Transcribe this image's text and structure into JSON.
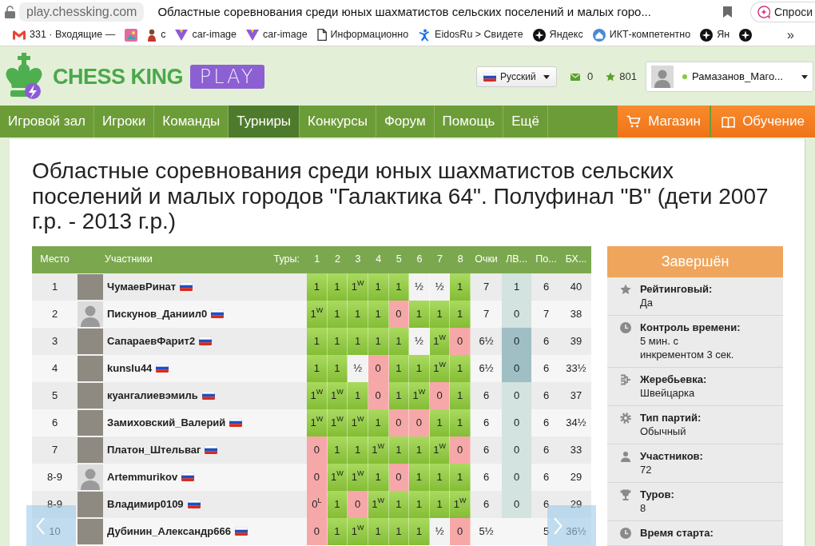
{
  "browser": {
    "url": "play.chessking.com",
    "page_title": "Областные соревнования среди юных шахматистов сельских поселений и малых горо...",
    "assistant_button": "Спроси"
  },
  "bookmarks": [
    {
      "kind": "mail",
      "label": "331 · Входящие —"
    },
    {
      "kind": "picture"
    },
    {
      "kind": "person",
      "label": "с"
    },
    {
      "kind": "v",
      "label": "car-image"
    },
    {
      "kind": "v",
      "label": "car-image"
    },
    {
      "kind": "document",
      "label": "Информационно"
    },
    {
      "kind": "figure",
      "label": "EidosRu > Свидете"
    },
    {
      "kind": "circle",
      "label": "Яндекс"
    },
    {
      "kind": "house",
      "label": "ИКТ-компетентно"
    },
    {
      "kind": "circle",
      "label": "Ян"
    },
    {
      "kind": "circle"
    }
  ],
  "bookmarks_more": "»",
  "header": {
    "logo": {
      "name": "CHESS KING",
      "badge": "PLAY"
    },
    "language": "Русский",
    "messages": "0",
    "rating": "801",
    "user": {
      "name": "Рамазанов_Маго...",
      "online": true
    }
  },
  "nav": [
    {
      "label": "Игровой зал",
      "selected": false
    },
    {
      "label": "Игроки",
      "selected": false
    },
    {
      "label": "Команды",
      "selected": false
    },
    {
      "label": "Турниры",
      "selected": true
    },
    {
      "label": "Конкурсы",
      "selected": false
    },
    {
      "label": "Форум",
      "selected": false
    },
    {
      "label": "Помощь",
      "selected": false
    },
    {
      "label": "Ещё",
      "selected": false
    }
  ],
  "nav_right": [
    {
      "kind": "cart",
      "label": "Магазин"
    },
    {
      "kind": "book",
      "label": "Обучение"
    }
  ],
  "tournament": {
    "title": "Областные соревнования среди юных шахматистов сельских поселений и малых городов \"Галактика 64\". Полуфинал \"В\" (дети 2007 г.р. - 2013 г.р.)",
    "standings": {
      "header": {
        "place": "Место",
        "players": "Участники",
        "rounds_label": "Туры:",
        "rounds": [
          "1",
          "2",
          "3",
          "4",
          "5",
          "6",
          "7",
          "8"
        ],
        "points": "Очки",
        "lv": "ЛВ...",
        "po": "По...",
        "bh": "БХ..."
      },
      "rows": [
        {
          "place": "1",
          "avatar": {
            "kind": "photo"
          },
          "name": "ЧумаевРинат",
          "results": [
            {
              "kind": "win",
              "text": "1"
            },
            {
              "kind": "win",
              "text": "1"
            },
            {
              "kind": "win",
              "text": "1$^{W}$"
            },
            {
              "kind": "win",
              "text": "1"
            },
            {
              "kind": "win",
              "text": "1"
            },
            {
              "kind": "draw",
              "text": "½"
            },
            {
              "kind": "draw",
              "text": "½"
            },
            {
              "kind": "win",
              "text": "1"
            }
          ],
          "points": "7",
          "lv": {
            "kind": "light",
            "text": "1"
          },
          "po": "6",
          "bh": "40"
        },
        {
          "place": "2",
          "avatar": {
            "kind": "default"
          },
          "name": "Пискунов_Даниил0",
          "results": [
            {
              "kind": "win",
              "text": "1$^{W}$"
            },
            {
              "kind": "win",
              "text": "1"
            },
            {
              "kind": "win",
              "text": "1"
            },
            {
              "kind": "win",
              "text": "1"
            },
            {
              "kind": "loss",
              "text": "0"
            },
            {
              "kind": "win",
              "text": "1"
            },
            {
              "kind": "win",
              "text": "1"
            },
            {
              "kind": "win",
              "text": "1"
            }
          ],
          "points": "7",
          "lv": {
            "kind": "light",
            "text": "0"
          },
          "po": "7",
          "bh": "38"
        },
        {
          "place": "3",
          "avatar": {
            "kind": "photo"
          },
          "name": "СапараевФарит2",
          "results": [
            {
              "kind": "win",
              "text": "1"
            },
            {
              "kind": "win",
              "text": "1"
            },
            {
              "kind": "win",
              "text": "1"
            },
            {
              "kind": "win",
              "text": "1"
            },
            {
              "kind": "win",
              "text": "1"
            },
            {
              "kind": "draw",
              "text": "½"
            },
            {
              "kind": "win",
              "text": "1$^{W}$"
            },
            {
              "kind": "loss",
              "text": "0"
            }
          ],
          "points": "6½",
          "lv": {
            "kind": "dark",
            "text": "0"
          },
          "po": "6",
          "bh": "39"
        },
        {
          "place": "4",
          "avatar": {
            "kind": "photo"
          },
          "name": "kunslu44",
          "results": [
            {
              "kind": "win",
              "text": "1"
            },
            {
              "kind": "win",
              "text": "1"
            },
            {
              "kind": "draw",
              "text": "½"
            },
            {
              "kind": "loss",
              "text": "0"
            },
            {
              "kind": "win",
              "text": "1"
            },
            {
              "kind": "win",
              "text": "1"
            },
            {
              "kind": "win",
              "text": "1$^{W}$"
            },
            {
              "kind": "win",
              "text": "1"
            }
          ],
          "points": "6½",
          "lv": {
            "kind": "dark",
            "text": "0"
          },
          "po": "6",
          "bh": "33½"
        },
        {
          "place": "5",
          "avatar": {
            "kind": "photo"
          },
          "name": "куангалиевэмиль",
          "results": [
            {
              "kind": "win",
              "text": "1$^{W}$"
            },
            {
              "kind": "win",
              "text": "1$^{W}$"
            },
            {
              "kind": "win",
              "text": "1"
            },
            {
              "kind": "loss",
              "text": "0"
            },
            {
              "kind": "win",
              "text": "1"
            },
            {
              "kind": "win",
              "text": "1$^{W}$"
            },
            {
              "kind": "loss",
              "text": "0"
            },
            {
              "kind": "win",
              "text": "1"
            }
          ],
          "points": "6",
          "lv": {
            "kind": "light",
            "text": "0"
          },
          "po": "6",
          "bh": "37"
        },
        {
          "place": "6",
          "avatar": {
            "kind": "photo"
          },
          "name": "Замиховский_Валерий",
          "results": [
            {
              "kind": "win",
              "text": "1$^{W}$"
            },
            {
              "kind": "win",
              "text": "1$^{W}$"
            },
            {
              "kind": "win",
              "text": "1$^{W}$"
            },
            {
              "kind": "win",
              "text": "1"
            },
            {
              "kind": "loss",
              "text": "0"
            },
            {
              "kind": "loss",
              "text": "0"
            },
            {
              "kind": "win",
              "text": "1"
            },
            {
              "kind": "win",
              "text": "1"
            }
          ],
          "points": "6",
          "lv": {
            "kind": "light",
            "text": "0"
          },
          "po": "6",
          "bh": "34½"
        },
        {
          "place": "7",
          "avatar": {
            "kind": "photo"
          },
          "name": "Платон_Штельваг",
          "results": [
            {
              "kind": "loss",
              "text": "0"
            },
            {
              "kind": "win",
              "text": "1"
            },
            {
              "kind": "win",
              "text": "1"
            },
            {
              "kind": "win",
              "text": "1$^{W}$"
            },
            {
              "kind": "win",
              "text": "1"
            },
            {
              "kind": "win",
              "text": "1"
            },
            {
              "kind": "win",
              "text": "1$^{W}$"
            },
            {
              "kind": "loss",
              "text": "0"
            }
          ],
          "points": "6",
          "lv": {
            "kind": "light",
            "text": "0"
          },
          "po": "6",
          "bh": "33"
        },
        {
          "place": "8-9",
          "avatar": {
            "kind": "default"
          },
          "name": "Artemmurikov",
          "results": [
            {
              "kind": "loss",
              "text": "0"
            },
            {
              "kind": "win",
              "text": "1$^{W}$"
            },
            {
              "kind": "win",
              "text": "1$^{W}$"
            },
            {
              "kind": "win",
              "text": "1"
            },
            {
              "kind": "loss",
              "text": "0"
            },
            {
              "kind": "win",
              "text": "1"
            },
            {
              "kind": "win",
              "text": "1"
            },
            {
              "kind": "win",
              "text": "1"
            }
          ],
          "points": "6",
          "lv": {
            "kind": "light",
            "text": "0"
          },
          "po": "6",
          "bh": "29"
        },
        {
          "place": "8-9",
          "avatar": {
            "kind": "photo"
          },
          "name": "Владимир0109",
          "results": [
            {
              "kind": "loss",
              "text": "0$^{L}$"
            },
            {
              "kind": "win",
              "text": "1"
            },
            {
              "kind": "loss",
              "text": "0"
            },
            {
              "kind": "win",
              "text": "1$^{W}$"
            },
            {
              "kind": "win",
              "text": "1"
            },
            {
              "kind": "win",
              "text": "1"
            },
            {
              "kind": "win",
              "text": "1"
            },
            {
              "kind": "win",
              "text": "1$^{W}$"
            }
          ],
          "points": "6",
          "lv": {
            "kind": "light",
            "text": "0"
          },
          "po": "6",
          "bh": "29"
        },
        {
          "place": "10",
          "avatar": {
            "kind": "photo"
          },
          "name": "Дубинин_Александр666",
          "results": [
            {
              "kind": "loss",
              "text": "0"
            },
            {
              "kind": "win",
              "text": "1"
            },
            {
              "kind": "win",
              "text": "1$^{W}$"
            },
            {
              "kind": "win",
              "text": "1"
            },
            {
              "kind": "win",
              "text": "1"
            },
            {
              "kind": "win",
              "text": "1"
            },
            {
              "kind": "draw",
              "text": "½"
            },
            {
              "kind": "loss",
              "text": "0"
            }
          ],
          "points": "5½",
          "lv": {
            "kind": "none"
          },
          "po": "5",
          "bh": "36½"
        }
      ]
    },
    "info": {
      "status": "Завершён",
      "items": [
        {
          "kind": "star",
          "label": "Рейтинговый:",
          "value": "Да"
        },
        {
          "kind": "clock",
          "label": "Контроль времени:",
          "value": "5 мин. с инкрементом 3 сек."
        },
        {
          "kind": "bracket",
          "label": "Жеребьевка:",
          "value": "Швейцарка"
        },
        {
          "kind": "gear",
          "label": "Тип партий:",
          "value": "Обычный"
        },
        {
          "kind": "user",
          "label": "Участников:",
          "value": "72"
        },
        {
          "kind": "trophy",
          "label": "Туров:",
          "value": "8"
        },
        {
          "kind": "clock",
          "label": "Время старта:"
        }
      ]
    }
  }
}
